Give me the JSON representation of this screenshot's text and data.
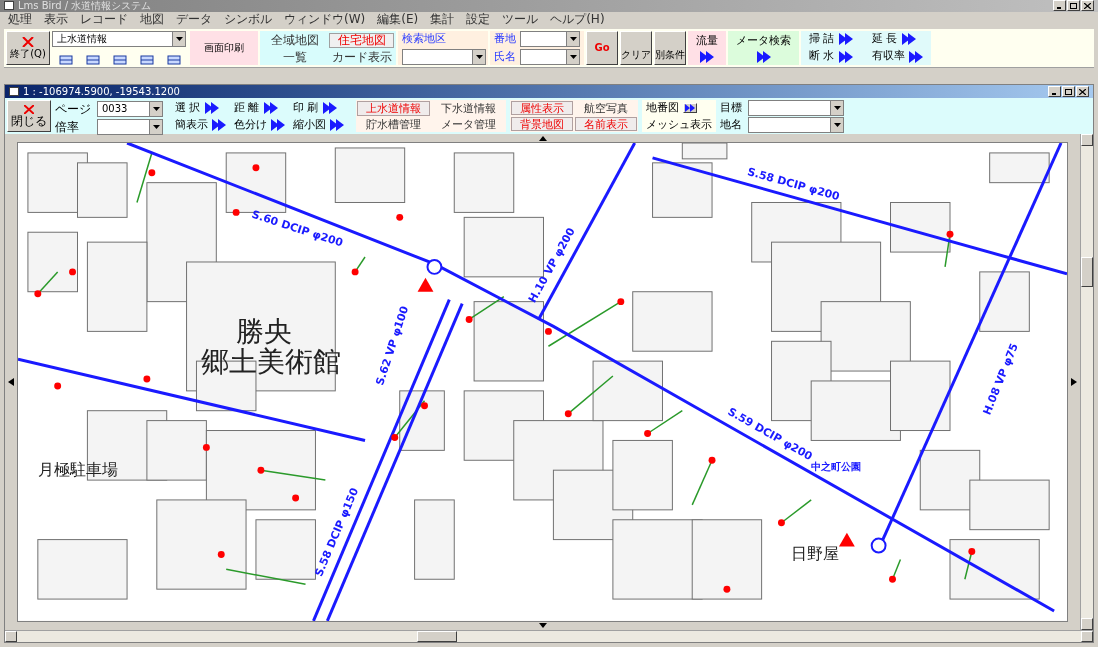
{
  "window": {
    "title": "Lms Bird / 水道情報システム"
  },
  "menu": [
    "処理",
    "表示",
    "レコード",
    "地図",
    "データ",
    "シンボル",
    "ウィンドウ(W)",
    "編集(E)",
    "集計",
    "設定",
    "ツール",
    "ヘルプ(H)"
  ],
  "toolbar": {
    "exit_button": "終了(Q)",
    "layer_select": {
      "value": "上水道情報"
    },
    "print_button": "画面印刷",
    "map_buttons": [
      {
        "label": "全域地図",
        "selected": false
      },
      {
        "label": "住宅地図",
        "selected": true
      },
      {
        "label": "一覧",
        "selected": false
      },
      {
        "label": "カード表示",
        "selected": false
      }
    ],
    "district": {
      "label": "検索地区"
    },
    "search_fields": [
      {
        "label": "番地"
      },
      {
        "label": "氏名"
      }
    ],
    "action_buttons": [
      "Go",
      "クリア",
      "別条件"
    ],
    "flow": {
      "label": "流量"
    },
    "meter_search": {
      "label": "メータ検索"
    },
    "tools": [
      "掃 詰",
      "延 長",
      "断 水",
      "有収率"
    ]
  },
  "map_window": {
    "title": "1 : -106974.5900, -19543.1200",
    "close_button": "閉じる",
    "page": {
      "label": "ページ",
      "value": "0033"
    },
    "scale": {
      "label": "倍率"
    },
    "tools": [
      "選 択",
      "距 離",
      "印 刷",
      "簡表示",
      "色分け",
      "縮小図"
    ],
    "layers": [
      {
        "label": "上水道情報",
        "on": true
      },
      {
        "label": "下水道情報",
        "on": false
      },
      {
        "label": "貯水槽管理",
        "on": false
      },
      {
        "label": "メータ管理",
        "on": false
      }
    ],
    "display": [
      {
        "label": "属性表示",
        "on": true
      },
      {
        "label": "航空写真",
        "on": false
      },
      {
        "label": "背景地図",
        "on": true
      },
      {
        "label": "名前表示",
        "on": true
      }
    ],
    "lot_map": {
      "label": "地番図"
    },
    "mesh": {
      "label": "メッシュ表示"
    },
    "targets": [
      {
        "label": "目標"
      },
      {
        "label": "地名"
      }
    ],
    "map_labels": [
      "S.60 DCIP φ200",
      "S.58 DCIP φ200",
      "S.62 VP φ100",
      "S.58 DCIP φ150",
      "S.59 DCIP φ200",
      "H.10 VP φ200",
      "H.08 VP φ75",
      "勝央",
      "郷土美術館",
      "月極駐車場",
      "日野屋",
      "中之町公園"
    ]
  }
}
